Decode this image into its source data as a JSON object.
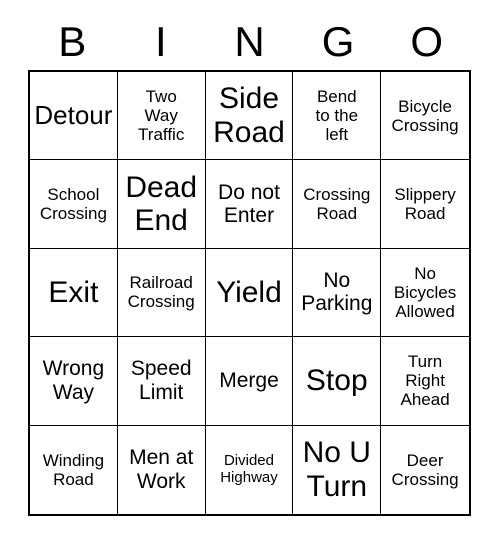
{
  "card": {
    "title": "BINGO",
    "columns": [
      "B",
      "I",
      "N",
      "G",
      "O"
    ],
    "rows": 5,
    "cols": 5,
    "border_color": "#000000",
    "background_color": "#ffffff",
    "text_color": "#000000"
  },
  "header": {
    "letters": [
      {
        "label": "B"
      },
      {
        "label": "I"
      },
      {
        "label": "N"
      },
      {
        "label": "G"
      },
      {
        "label": "O"
      }
    ]
  },
  "cells": [
    {
      "id": "r1c1",
      "row": 1,
      "col": 1,
      "text": "Detour",
      "size": "lg",
      "marked": false
    },
    {
      "id": "r1c2",
      "row": 1,
      "col": 2,
      "text": "Two\nWay\nTraffic",
      "size": "sm",
      "marked": false
    },
    {
      "id": "r1c3",
      "row": 1,
      "col": 3,
      "text": "Side\nRoad",
      "size": "xl",
      "marked": false
    },
    {
      "id": "r1c4",
      "row": 1,
      "col": 4,
      "text": "Bend\nto the\nleft",
      "size": "sm",
      "marked": false
    },
    {
      "id": "r1c5",
      "row": 1,
      "col": 5,
      "text": "Bicycle\nCrossing",
      "size": "sm",
      "marked": false
    },
    {
      "id": "r2c1",
      "row": 2,
      "col": 1,
      "text": "School\nCrossing",
      "size": "sm",
      "marked": false
    },
    {
      "id": "r2c2",
      "row": 2,
      "col": 2,
      "text": "Dead\nEnd",
      "size": "xl",
      "marked": false
    },
    {
      "id": "r2c3",
      "row": 2,
      "col": 3,
      "text": "Do not\nEnter",
      "size": "md",
      "marked": false
    },
    {
      "id": "r2c4",
      "row": 2,
      "col": 4,
      "text": "Crossing\nRoad",
      "size": "sm",
      "marked": false
    },
    {
      "id": "r2c5",
      "row": 2,
      "col": 5,
      "text": "Slippery\nRoad",
      "size": "sm",
      "marked": false
    },
    {
      "id": "r3c1",
      "row": 3,
      "col": 1,
      "text": "Exit",
      "size": "xl",
      "marked": false
    },
    {
      "id": "r3c2",
      "row": 3,
      "col": 2,
      "text": "Railroad\nCrossing",
      "size": "sm",
      "marked": false
    },
    {
      "id": "r3c3",
      "row": 3,
      "col": 3,
      "text": "Yield",
      "size": "xl",
      "marked": false
    },
    {
      "id": "r3c4",
      "row": 3,
      "col": 4,
      "text": "No\nParking",
      "size": "md",
      "marked": false
    },
    {
      "id": "r3c5",
      "row": 3,
      "col": 5,
      "text": "No\nBicycles\nAllowed",
      "size": "sm",
      "marked": false
    },
    {
      "id": "r4c1",
      "row": 4,
      "col": 1,
      "text": "Wrong\nWay",
      "size": "md",
      "marked": false
    },
    {
      "id": "r4c2",
      "row": 4,
      "col": 2,
      "text": "Speed\nLimit",
      "size": "md",
      "marked": false
    },
    {
      "id": "r4c3",
      "row": 4,
      "col": 3,
      "text": "Merge",
      "size": "md",
      "marked": false
    },
    {
      "id": "r4c4",
      "row": 4,
      "col": 4,
      "text": "Stop",
      "size": "xl",
      "marked": false
    },
    {
      "id": "r4c5",
      "row": 4,
      "col": 5,
      "text": "Turn\nRight\nAhead",
      "size": "sm",
      "marked": false
    },
    {
      "id": "r5c1",
      "row": 5,
      "col": 1,
      "text": "Winding\nRoad",
      "size": "sm",
      "marked": false
    },
    {
      "id": "r5c2",
      "row": 5,
      "col": 2,
      "text": "Men at\nWork",
      "size": "md",
      "marked": false
    },
    {
      "id": "r5c3",
      "row": 5,
      "col": 3,
      "text": "Divided\nHighway",
      "size": "xs",
      "marked": false
    },
    {
      "id": "r5c4",
      "row": 5,
      "col": 4,
      "text": "No U\nTurn",
      "size": "xl",
      "marked": false
    },
    {
      "id": "r5c5",
      "row": 5,
      "col": 5,
      "text": "Deer\nCrossing",
      "size": "sm",
      "marked": false
    }
  ]
}
